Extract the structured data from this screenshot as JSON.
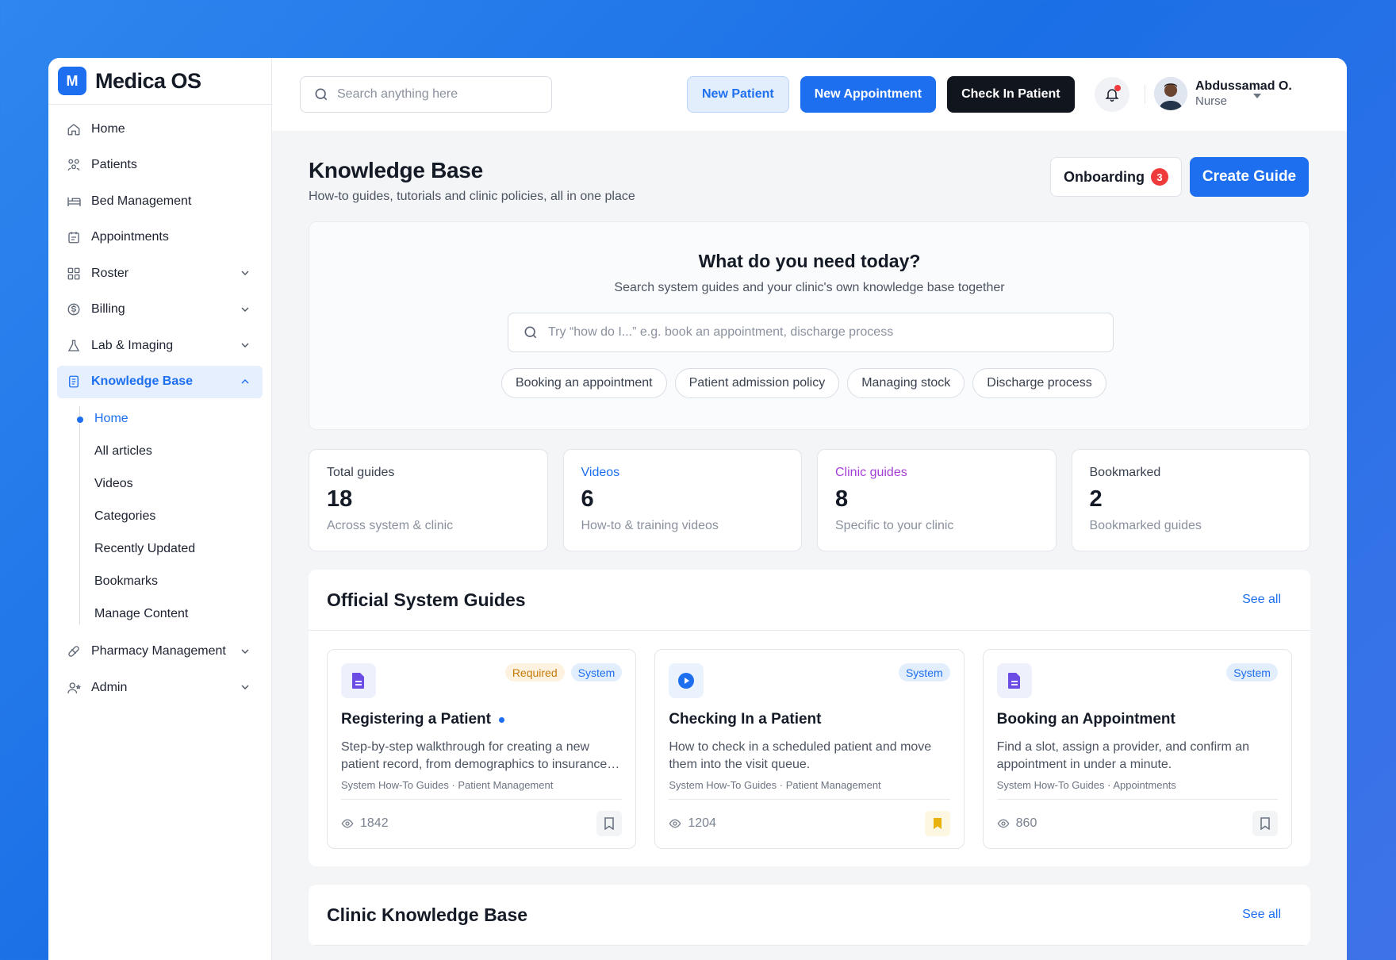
{
  "brand": {
    "logo_letter": "M",
    "name": "Medica OS"
  },
  "sidebar": {
    "items": [
      {
        "label": "Home",
        "icon": "home-icon"
      },
      {
        "label": "Patients",
        "icon": "patients-icon"
      },
      {
        "label": "Bed Management",
        "icon": "bed-icon"
      },
      {
        "label": "Appointments",
        "icon": "calendar-icon"
      },
      {
        "label": "Roster",
        "icon": "grid-icon",
        "expandable": true
      },
      {
        "label": "Billing",
        "icon": "dollar-icon",
        "expandable": true
      },
      {
        "label": "Lab & Imaging",
        "icon": "flask-icon",
        "expandable": true
      },
      {
        "label": "Knowledge Base",
        "icon": "book-icon",
        "expandable": true,
        "active": true
      },
      {
        "label": "Pharmacy Management",
        "icon": "pill-icon",
        "expandable": true
      },
      {
        "label": "Admin",
        "icon": "admin-icon",
        "expandable": true
      }
    ],
    "knowledge_sub": [
      "Home",
      "All articles",
      "Videos",
      "Categories",
      "Recently Updated",
      "Bookmarks",
      "Manage Content"
    ],
    "active_sub": "Home"
  },
  "topbar": {
    "search_placeholder": "Search anything here",
    "new_patient": "New Patient",
    "new_appointment": "New Appointment",
    "check_in": "Check In Patient",
    "user_name": "Abdussamad O.",
    "user_role": "Nurse"
  },
  "page": {
    "title": "Knowledge Base",
    "subtitle": "How-to guides, tutorials and clinic policies, all in one place",
    "onboarding_label": "Onboarding",
    "onboarding_count": "3",
    "create_guide": "Create Guide"
  },
  "hero": {
    "title": "What do you need today?",
    "subtitle": "Search system guides and your clinic's own knowledge base together",
    "search_placeholder": "Try “how do I...” e.g. book an appointment, discharge process",
    "chips": [
      "Booking an appointment",
      "Patient admission policy",
      "Managing stock",
      "Discharge process"
    ]
  },
  "stats": [
    {
      "label": "Total guides",
      "value": "18",
      "desc": "Across system & clinic",
      "label_color": "#3a4250"
    },
    {
      "label": "Videos",
      "value": "6",
      "desc": "How-to & training videos",
      "label_color": "#1d6ff0"
    },
    {
      "label": "Clinic guides",
      "value": "8",
      "desc": "Specific to your clinic",
      "label_color": "#a33fd6"
    },
    {
      "label": "Bookmarked",
      "value": "2",
      "desc": "Bookmarked guides",
      "label_color": "#3a4250"
    }
  ],
  "official": {
    "title": "Official System Guides",
    "see_all": "See all",
    "cards": [
      {
        "icon": "document-icon",
        "tags": [
          "Required",
          "System"
        ],
        "title": "Registering a Patient",
        "is_new": true,
        "desc": "Step-by-step walkthrough for creating a new patient record, from demographics to insurance…",
        "meta": "System How-To Guides · Patient Management",
        "views": "1842",
        "bookmarked": false
      },
      {
        "icon": "play-icon",
        "tags": [
          "System"
        ],
        "title": "Checking In a Patient",
        "is_new": false,
        "desc": "How to check in a scheduled patient and move them into the visit queue.",
        "meta": "System How-To Guides · Patient Management",
        "views": "1204",
        "bookmarked": true
      },
      {
        "icon": "document-icon",
        "tags": [
          "System"
        ],
        "title": "Booking an Appointment",
        "is_new": false,
        "desc": "Find a slot, assign a provider, and confirm an appointment in under a minute.",
        "meta": "System How-To Guides · Appointments",
        "views": "860",
        "bookmarked": false
      }
    ]
  },
  "clinic": {
    "title": "Clinic Knowledge Base",
    "see_all": "See all"
  },
  "colors": {
    "accent": "#1d6ff0",
    "danger": "#ef3b3b",
    "bookmark_active": "#e8b10b"
  }
}
